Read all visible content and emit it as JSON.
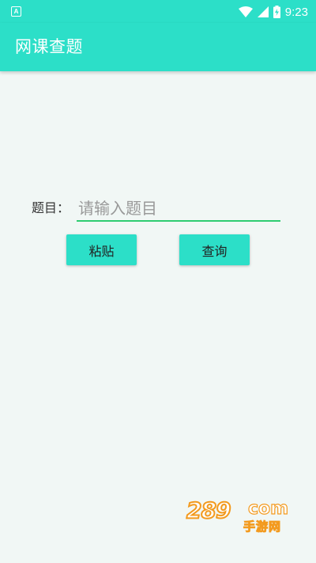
{
  "status_bar": {
    "app_icon_letter": "A",
    "time": "9:23",
    "icons": [
      "wifi-icon",
      "signal-icon",
      "battery-charging-icon"
    ]
  },
  "app_bar": {
    "title": "网课查题"
  },
  "form": {
    "label": "题目：",
    "input_placeholder": "请输入题目",
    "input_value": "",
    "paste_label": "粘贴",
    "query_label": "查询"
  },
  "watermark": {
    "number": "289",
    "domain": "com",
    "subtitle": "手游网"
  },
  "colors": {
    "primary": "#2cdfc8",
    "background": "#f1f7f5",
    "input_underline": "#2ecc71",
    "watermark": "#f39a1e"
  }
}
